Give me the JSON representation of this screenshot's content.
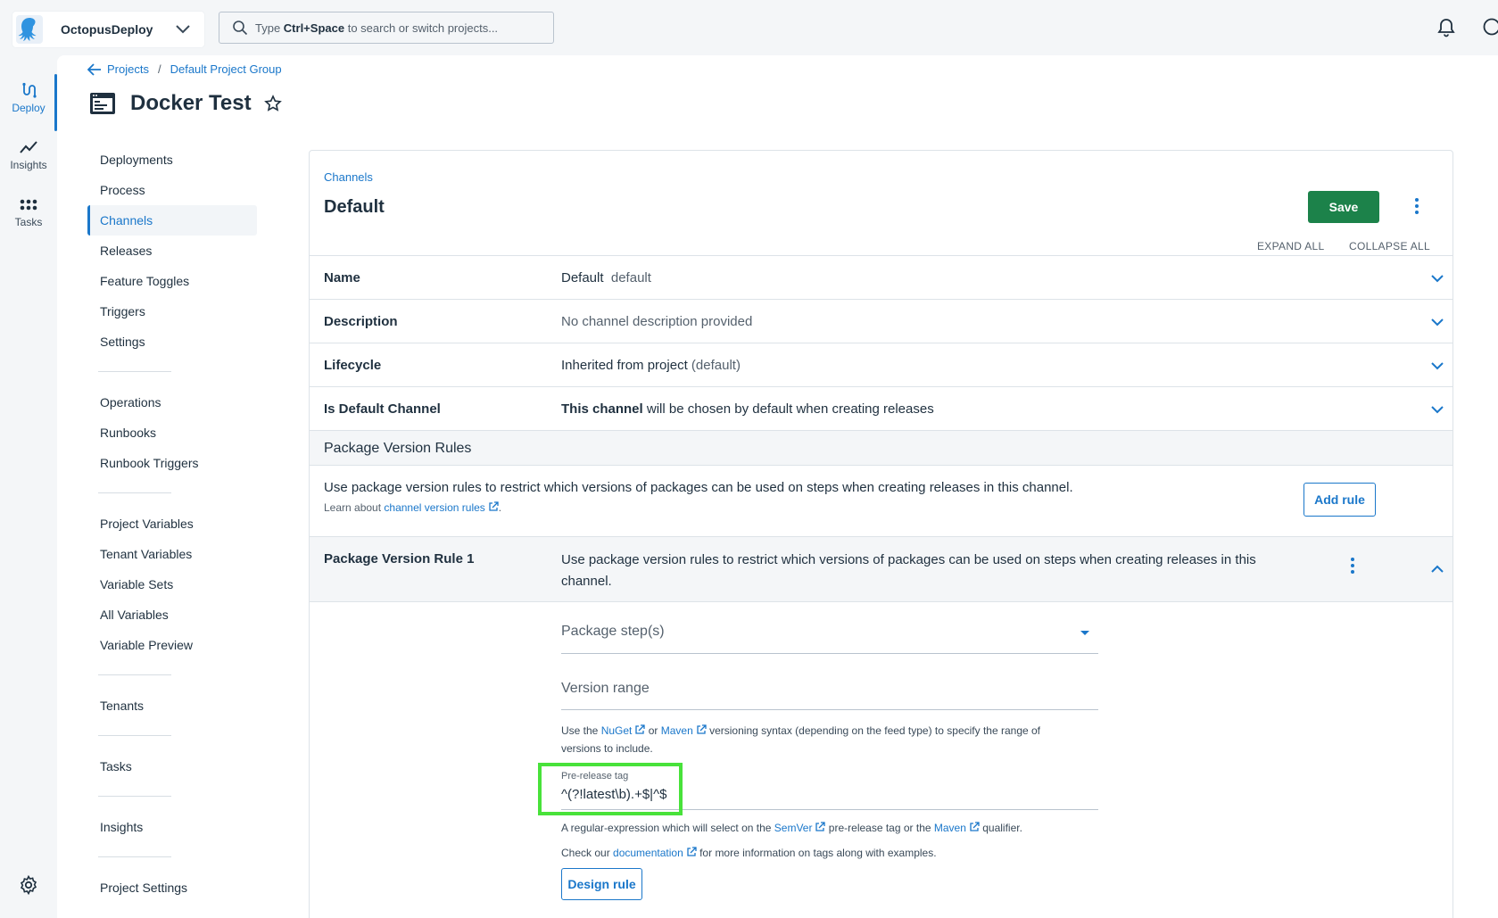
{
  "topbar": {
    "space_name": "OctopusDeploy",
    "search_placeholder_prefix": "Type ",
    "search_placeholder_key": "Ctrl+Space",
    "search_placeholder_suffix": " to search or switch projects..."
  },
  "rail": {
    "items": [
      {
        "label": "Deploy",
        "icon": "deploy-icon"
      },
      {
        "label": "Insights",
        "icon": "insights-icon"
      },
      {
        "label": "Tasks",
        "icon": "tasks-icon"
      }
    ]
  },
  "breadcrumb": {
    "items": [
      "Projects",
      "Default Project Group"
    ],
    "separator": "/"
  },
  "project": {
    "title": "Docker Test"
  },
  "sidenav": {
    "groups": [
      [
        "Deployments",
        "Process",
        "Channels",
        "Releases",
        "Feature Toggles",
        "Triggers",
        "Settings"
      ],
      [
        "Operations",
        "Runbooks",
        "Runbook Triggers"
      ],
      [
        "Project Variables",
        "Tenant Variables",
        "Variable Sets",
        "All Variables",
        "Variable Preview"
      ],
      [
        "Tenants"
      ],
      [
        "Tasks"
      ],
      [
        "Insights"
      ],
      [
        "Project Settings"
      ]
    ],
    "active": "Channels"
  },
  "card": {
    "crumb": "Channels",
    "title": "Default",
    "save_label": "Save",
    "expand_all": "EXPAND ALL",
    "collapse_all": "COLLAPSE ALL"
  },
  "rows": {
    "name": {
      "label": "Name",
      "value": "Default",
      "muted": "default"
    },
    "description": {
      "label": "Description",
      "value": "No channel description provided"
    },
    "lifecycle": {
      "label": "Lifecycle",
      "value": "Inherited from project",
      "muted": "(default)"
    },
    "is_default": {
      "label": "Is Default Channel",
      "bold": "This channel",
      "value": " will be chosen by default when creating releases"
    }
  },
  "pvr": {
    "header": "Package Version Rules",
    "description": "Use package version rules to restrict which versions of packages can be used on steps when creating releases in this channel.",
    "learn_prefix": "Learn about ",
    "learn_link": "channel version rules",
    "learn_suffix": ".",
    "add_rule_label": "Add rule"
  },
  "rule1": {
    "label": "Package Version Rule 1",
    "description": "Use package version rules to restrict which versions of packages can be used on steps when creating releases in this channel.",
    "package_steps_placeholder": "Package step(s)",
    "version_range_placeholder": "Version range",
    "help1_a": "Use the ",
    "help1_nuget": "NuGet",
    "help1_b": " or ",
    "help1_maven": "Maven",
    "help1_c": " versioning syntax (depending on the feed type) to specify the range of versions to include.",
    "prerelease_label": "Pre-release tag",
    "prerelease_value": "^(?!latest\\b).+$|^$",
    "help2_a": "A regular-expression which will select on the ",
    "help2_semver": "SemVer",
    "help2_b": " pre-release tag or the ",
    "help2_maven": "Maven",
    "help2_c": " qualifier.",
    "help3_a": "Check our ",
    "help3_doc": "documentation",
    "help3_b": " for more information on tags along with examples.",
    "design_rule_label": "Design rule"
  },
  "colors": {
    "accent": "#1a77ca",
    "save": "#1c824a",
    "highlight": "#48e23a"
  }
}
